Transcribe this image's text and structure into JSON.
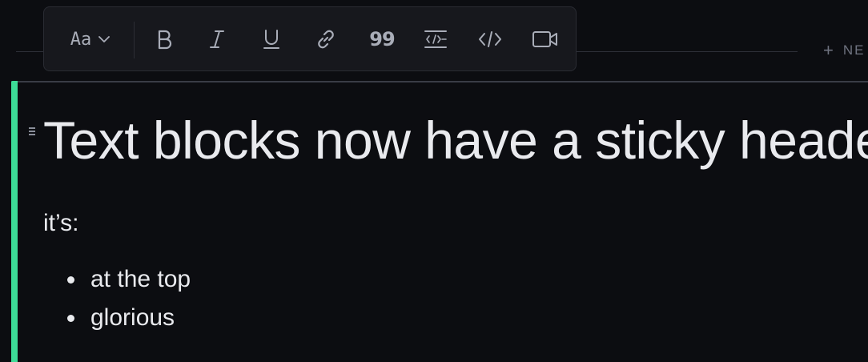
{
  "toolbar": {
    "format_label": "Aa",
    "quote_glyph": "99",
    "icons": [
      "chevron-down",
      "bold",
      "italic",
      "underline",
      "link",
      "quote",
      "code-block",
      "code",
      "video"
    ]
  },
  "header": {
    "new_label": "NE"
  },
  "editor": {
    "heading": "Text blocks now have a sticky header",
    "paragraph": "it’s:",
    "list_items": [
      "at the top",
      "glorious"
    ]
  },
  "colors": {
    "background": "#0c0d11",
    "accent": "#3ddc97",
    "text": "#e9eaee",
    "toolbar_bg": "#17181d",
    "icon": "#a9adb8"
  }
}
